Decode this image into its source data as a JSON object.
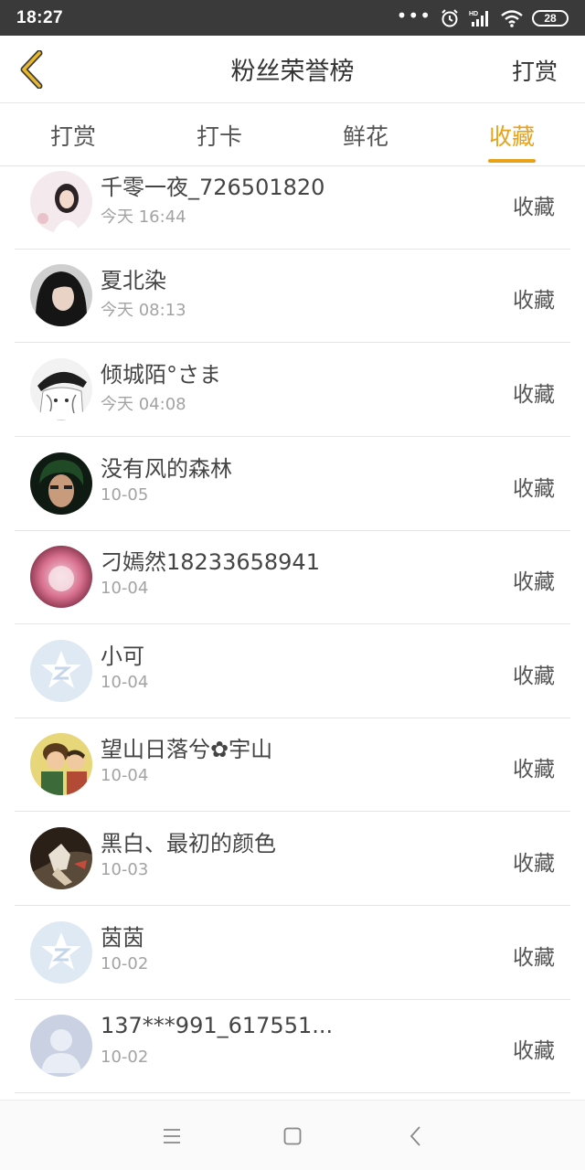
{
  "status_bar": {
    "time": "18:27",
    "dots": "•••",
    "battery": "28"
  },
  "header": {
    "title": "粉丝荣誉榜",
    "action": "打赏"
  },
  "tabs": [
    {
      "label": "打赏",
      "active": false
    },
    {
      "label": "打卡",
      "active": false
    },
    {
      "label": "鲜花",
      "active": false
    },
    {
      "label": "收藏",
      "active": true
    }
  ],
  "colors": {
    "accent": "#e8a21a",
    "status_bar": "#3a3a3a",
    "divider": "#e5e5e5",
    "muted_text": "#a3a3a3"
  },
  "list": [
    {
      "name": "千零一夜_726501820",
      "time": "今天 16:44",
      "action": "收藏",
      "avatar": "photo-avatar"
    },
    {
      "name": "夏北染",
      "time": "今天 08:13",
      "action": "收藏",
      "avatar": "photo-avatar"
    },
    {
      "name": "倾城陌°さま",
      "time": "今天 04:08",
      "action": "收藏",
      "avatar": "anime-avatar"
    },
    {
      "name": "没有风的森林",
      "time": "10-05",
      "action": "收藏",
      "avatar": "photo-avatar"
    },
    {
      "name": "刁嫣然18233658941",
      "time": "10-04",
      "action": "收藏",
      "avatar": "photo-avatar"
    },
    {
      "name": "小可",
      "time": "10-04",
      "action": "收藏",
      "avatar": "qzone-default-avatar"
    },
    {
      "name": "望山日落兮✿宇山",
      "time": "10-04",
      "action": "收藏",
      "avatar": "cartoon-avatar"
    },
    {
      "name": "黑白、最初的颜色",
      "time": "10-03",
      "action": "收藏",
      "avatar": "photo-avatar"
    },
    {
      "name": "茵茵",
      "time": "10-02",
      "action": "收藏",
      "avatar": "qzone-default-avatar"
    },
    {
      "name": "137***991_617551...",
      "time": "10-02",
      "action": "收藏",
      "avatar": "default-person-avatar"
    }
  ],
  "navbar": {
    "menu_icon": "menu-icon",
    "home_icon": "home-icon",
    "back_icon": "back-icon"
  }
}
